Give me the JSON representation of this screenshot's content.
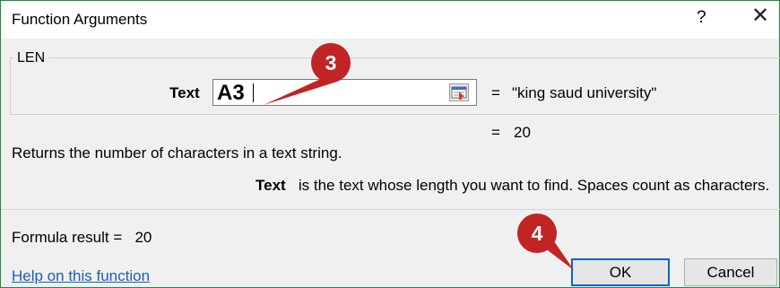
{
  "dialog": {
    "title": "Function Arguments",
    "help_button": "?",
    "close_button": "✕",
    "function_name": "LEN",
    "arguments": [
      {
        "label": "Text",
        "value": "A3",
        "evaluated": "\"king saud university\""
      }
    ],
    "result_preview": "20",
    "equals": "=",
    "description": "Returns the number of characters in a text string.",
    "argument_help": {
      "name": "Text",
      "text": "is the text whose length you want to find. Spaces count as characters."
    },
    "formula_result_label": "Formula result =",
    "formula_result_value": "20",
    "help_link": "Help on this function",
    "ok_label": "OK",
    "cancel_label": "Cancel"
  },
  "callouts": [
    {
      "number": "3",
      "target": "text-argument-input"
    },
    {
      "number": "4",
      "target": "ok-button"
    }
  ],
  "colors": {
    "callout": "#c02424",
    "link": "#1a5fb4",
    "ok_border": "#0a64d0",
    "frame_border": "#1e8a3c"
  },
  "icons": {
    "collapse": "collapse-dialog-icon",
    "close": "close-icon"
  }
}
